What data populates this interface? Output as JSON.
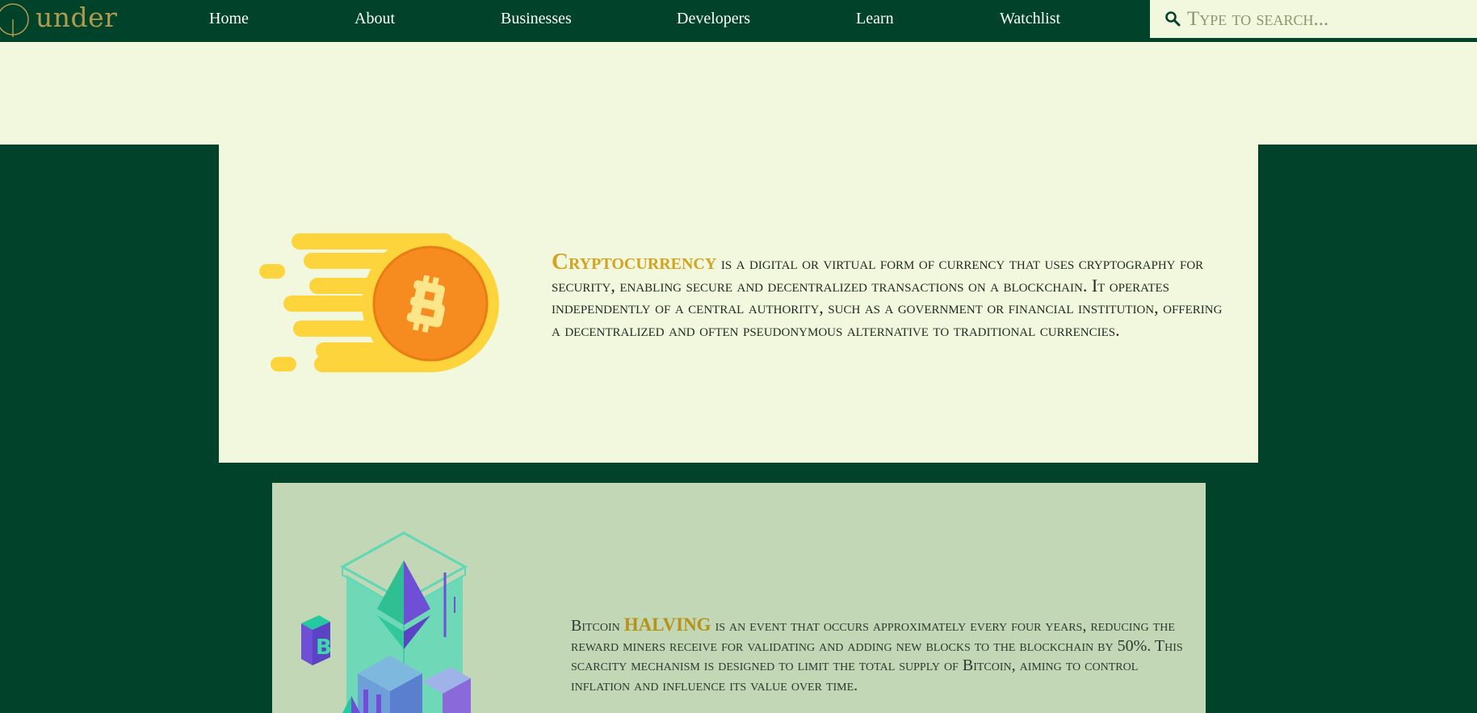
{
  "brand": {
    "name": "under"
  },
  "nav": {
    "items": [
      {
        "label": "Home"
      },
      {
        "label": "About"
      },
      {
        "label": "Businesses"
      },
      {
        "label": "Developers"
      },
      {
        "label": "Learn"
      },
      {
        "label": "Watchlist"
      }
    ]
  },
  "search": {
    "placeholder": "Type to search...",
    "icon": "search-icon"
  },
  "cards": [
    {
      "highlight": "Cryptocurrency",
      "text": " is a digital or virtual form of currency that uses cryptography for security, enabling secure and decentralized transactions on a blockchain. It operates independently of a central authority, such as a government or financial institution, offering a decentralized and often pseudonymous alternative to traditional currencies.",
      "image_icon": "bitcoin-coin-icon"
    },
    {
      "prefix": "Bitcoin ",
      "highlight": "HALVING",
      "text": " is an event that occurs approximately every four years, reducing the reward miners receive for validating and adding new blocks to the blockchain by 50%. This scarcity mechanism is designed to limit the total supply of Bitcoin, aiming to control inflation and influence its value over time.",
      "image_icon": "blockchain-isometric-icon"
    }
  ],
  "colors": {
    "primary": "#00432a",
    "cream": "#f1f8dd",
    "gold": "#d3a322",
    "sage": "#c1d7b5",
    "logo": "#b19a4d"
  }
}
